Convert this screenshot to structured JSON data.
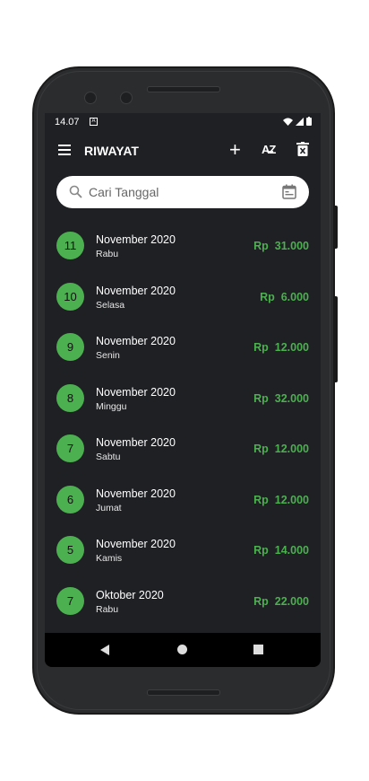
{
  "statusbar": {
    "time": "14.07",
    "notif_letter": "A"
  },
  "appbar": {
    "title": "RIWAYAT",
    "add_glyph": "+",
    "sort_glyph": "A̶Z"
  },
  "search": {
    "placeholder": "Cari Tanggal"
  },
  "entries": [
    {
      "day": "11",
      "month": "November 2020",
      "weekday": "Rabu",
      "amount": "Rp  31.000"
    },
    {
      "day": "10",
      "month": "November 2020",
      "weekday": "Selasa",
      "amount": "Rp  6.000"
    },
    {
      "day": "9",
      "month": "November 2020",
      "weekday": "Senin",
      "amount": "Rp  12.000"
    },
    {
      "day": "8",
      "month": "November 2020",
      "weekday": "Minggu",
      "amount": "Rp  32.000"
    },
    {
      "day": "7",
      "month": "November 2020",
      "weekday": "Sabtu",
      "amount": "Rp  12.000"
    },
    {
      "day": "6",
      "month": "November 2020",
      "weekday": "Jumat",
      "amount": "Rp  12.000"
    },
    {
      "day": "5",
      "month": "November 2020",
      "weekday": "Kamis",
      "amount": "Rp  14.000"
    },
    {
      "day": "7",
      "month": "Oktober 2020",
      "weekday": "Rabu",
      "amount": "Rp  22.000"
    }
  ],
  "colors": {
    "accent": "#4caf50",
    "background": "#1f2024"
  },
  "icons": [
    "menu-icon",
    "add-icon",
    "sort-az-icon",
    "delete-icon",
    "search-icon",
    "calendar-icon",
    "back-icon",
    "home-icon",
    "recents-icon"
  ]
}
